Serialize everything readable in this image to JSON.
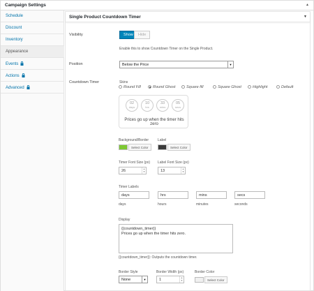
{
  "header": {
    "title": "Campaign Settings"
  },
  "sidebar": {
    "items": [
      {
        "label": "Schedule"
      },
      {
        "label": "Discount"
      },
      {
        "label": "Inventory"
      },
      {
        "label": "Appearance"
      },
      {
        "label": "Events"
      },
      {
        "label": "Actions"
      },
      {
        "label": "Advanced"
      }
    ]
  },
  "panel": {
    "title": "Single Product Countdown Timer"
  },
  "visibility": {
    "label": "Visibility",
    "show": "Show",
    "hide": "Hide",
    "help": "Enable this to show Countdown Timer on the Single Product."
  },
  "position": {
    "label": "Position",
    "value": "Below the Price"
  },
  "countdown": {
    "label": "Countdown Timer",
    "skins_label": "Skins",
    "skins": [
      "Round Fill",
      "Round Ghost",
      "Square fill",
      "Square Ghost",
      "Highlight",
      "Default"
    ],
    "selected_skin": "Round Ghost",
    "preview": {
      "units": [
        {
          "value": "02",
          "unit": "days"
        },
        {
          "value": "10",
          "unit": "hrs"
        },
        {
          "value": "33",
          "unit": "mins"
        },
        {
          "value": "05",
          "unit": "secs"
        }
      ],
      "text": "Prices go up when the timer hits zero"
    }
  },
  "colors": {
    "bg_label": "Background/Border",
    "bg_color": "#7dc832",
    "label_label": "Label",
    "label_color": "#3a3a3a",
    "select_color": "Select Color"
  },
  "font_sizes": {
    "timer_label": "Timer Font Size (px)",
    "timer_value": "26",
    "label_label": "Label Font Size (px)",
    "label_value": "13"
  },
  "timer_labels": {
    "label": "Timer Labels",
    "fields": [
      {
        "value": "days",
        "caption": "days"
      },
      {
        "value": "hrs",
        "caption": "hours"
      },
      {
        "value": "mins",
        "caption": "minutes"
      },
      {
        "value": "secs",
        "caption": "seconds"
      }
    ]
  },
  "display": {
    "label": "Display",
    "line1": "{{countdown_timer}}",
    "line2": "Prices go up when the timer hits zero.",
    "help": "{{countdown_timer}}: Outputs the countdown timer."
  },
  "border": {
    "style_label": "Border Style",
    "style_value": "None",
    "width_label": "Border Width (px)",
    "width_value": "1",
    "color_label": "Border Color",
    "color": "#f0f0f0",
    "select_color": "Select Color"
  },
  "theme": {
    "accent": "#0085ba",
    "link": "#0073aa"
  },
  "icons": {
    "lock": "lock-icon",
    "toggle": "triangle-up-icon",
    "collapse": "triangle-down-icon"
  }
}
